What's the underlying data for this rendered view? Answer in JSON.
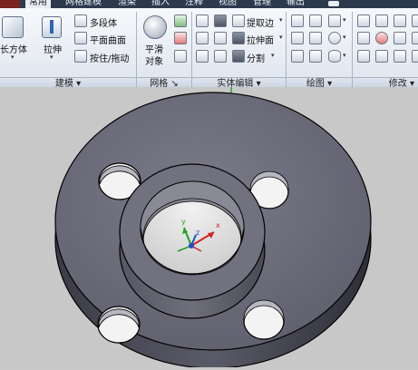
{
  "tabs": [
    {
      "label": "常用",
      "active": true
    },
    {
      "label": "网格建模"
    },
    {
      "label": "渲染"
    },
    {
      "label": "插入"
    },
    {
      "label": "注释"
    },
    {
      "label": "视图"
    },
    {
      "label": "管理"
    },
    {
      "label": "输出"
    }
  ],
  "panels": {
    "modeling": {
      "title": "建模",
      "box_label": "长方体",
      "extrude_label": "拉伸",
      "polysolid_label": "多段体",
      "planar_surface_label": "平面曲面",
      "presspull_label": "按住/拖动"
    },
    "mesh": {
      "title": "网格",
      "smooth_label": "平滑",
      "object_label": "对象"
    },
    "solid_editing": {
      "title": "实体编辑",
      "extract_edges_label": "提取边",
      "extrude_faces_label": "拉伸面",
      "separate_label": "分割"
    },
    "draw": {
      "title": "绘图"
    },
    "modify": {
      "title": "修改"
    }
  },
  "viewport": {
    "model": "flange-with-four-bolt-holes",
    "ucs": {
      "x": "x",
      "y": "y",
      "z": "z"
    }
  }
}
